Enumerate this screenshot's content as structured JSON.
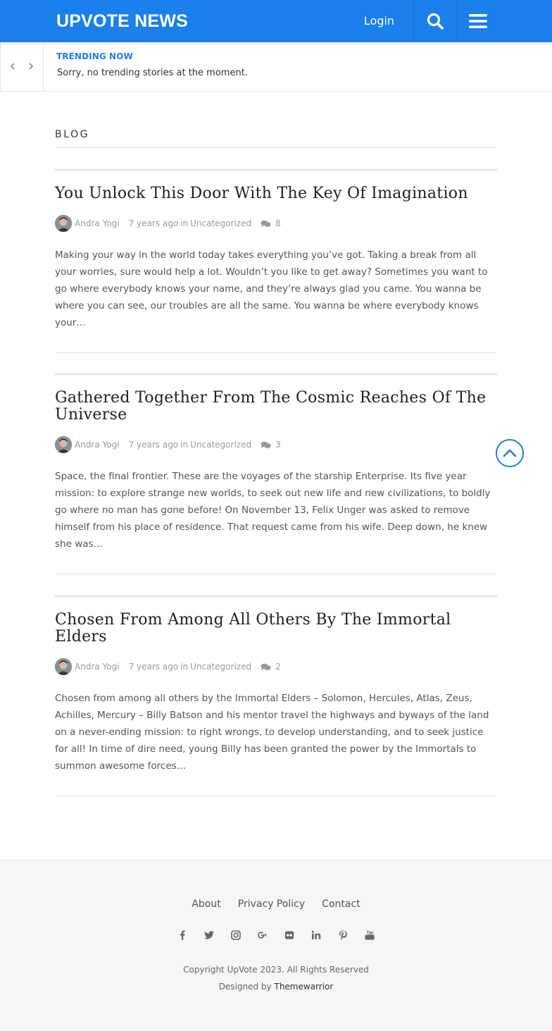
{
  "header": {
    "logo": "UPVOTE NEWS",
    "login_label": "Login",
    "icons": {
      "search": "search-icon",
      "menu": "hamburger-menu-icon"
    },
    "brand_color": "#1b80ec"
  },
  "trending": {
    "label": "TRENDING NOW",
    "text": "Sorry, no trending stories at the moment.",
    "icons": {
      "prev": "chevron-left-icon",
      "next": "chevron-right-icon"
    }
  },
  "blog": {
    "heading": "BLOG"
  },
  "posts": [
    {
      "title": "You Unlock This Door With The Key Of Imagination",
      "author": "Andra Yogi",
      "date": "7 years ago",
      "in_label": "in",
      "category": "Uncategorized",
      "comments": "8",
      "excerpt": "Making your way in the world today takes everything you’ve got. Taking a break from all your worries, sure would help a lot. Wouldn’t you like to get away? Sometimes you want to go where everybody knows your name, and they’re always glad you came. You wanna be where you can see, our troubles are all the same. You wanna be where everybody knows your…"
    },
    {
      "title": "Gathered Together From The Cosmic Reaches Of The Universe",
      "author": "Andra Yogi",
      "date": "7 years ago",
      "in_label": "in",
      "category": "Uncategorized",
      "comments": "3",
      "excerpt": "Space, the final frontier. These are the voyages of the starship Enterprise. Its five year mission: to explore strange new worlds, to seek out new life and new civilizations, to boldly go where no man has gone before! On November 13, Felix Unger was asked to remove himself from his place of residence. That request came from his wife. Deep down, he knew she was…"
    },
    {
      "title": "Chosen From Among All Others By The Immortal Elders",
      "author": "Andra Yogi",
      "date": "7 years ago",
      "in_label": "in",
      "category": "Uncategorized",
      "comments": "2",
      "excerpt": "Chosen from among all others by the Immortal Elders – Solomon, Hercules, Atlas, Zeus, Achilles, Mercury – Billy Batson and his mentor travel the highways and byways of the land on a never-ending mission: to right wrongs, to develop understanding, and to seek justice for all! In time of dire need, young Billy has been granted the power by the Immortals to summon awesome forces…"
    }
  ],
  "footer": {
    "links": [
      "About",
      "Privacy Policy",
      "Contact"
    ],
    "socials": [
      "facebook-icon",
      "twitter-icon",
      "instagram-icon",
      "google-plus-icon",
      "flickr-icon",
      "linkedin-icon",
      "pinterest-icon",
      "youtube-icon"
    ],
    "copyright": "Copyright UpVote 2023. All Rights Reserved",
    "designed_by": "Designed by",
    "designer": "Themewarrior"
  }
}
